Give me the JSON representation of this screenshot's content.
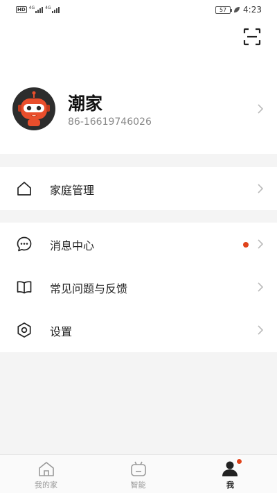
{
  "status_bar": {
    "hd": "HD",
    "net1": "4G",
    "net2": "4G",
    "battery": "57",
    "time": "4:23"
  },
  "profile": {
    "nickname": "潮家",
    "phone": "86-16619746026"
  },
  "menu": {
    "family": {
      "label": "家庭管理",
      "icon": "house-icon"
    },
    "messages": {
      "label": "消息中心",
      "icon": "chat-bubble-icon",
      "unread": true
    },
    "faq": {
      "label": "常见问题与反馈",
      "icon": "open-book-icon"
    },
    "settings": {
      "label": "设置",
      "icon": "hexagon-gear-icon"
    }
  },
  "tabs": [
    {
      "label": "我的家",
      "icon": "home-icon",
      "active": false
    },
    {
      "label": "智能",
      "icon": "robot-icon",
      "active": false
    },
    {
      "label": "我",
      "icon": "user-icon",
      "active": true
    }
  ],
  "colors": {
    "accent": "#e0431b",
    "avatar_face": "#e94e2c",
    "avatar_bg": "#2d2d2d"
  }
}
